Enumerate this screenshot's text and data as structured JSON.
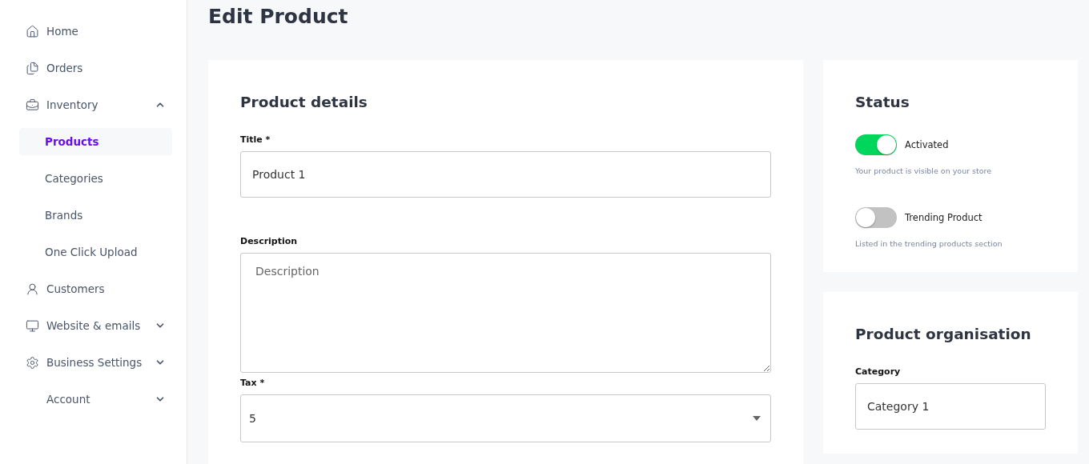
{
  "sidebar": {
    "items": [
      {
        "label": "Home",
        "selected": false
      },
      {
        "label": "Orders",
        "selected": false
      },
      {
        "label": "Inventory",
        "selected": false,
        "expanded": true,
        "children": [
          {
            "label": "Products",
            "selected": true
          },
          {
            "label": "Categories",
            "selected": false
          },
          {
            "label": "Brands",
            "selected": false
          },
          {
            "label": "One Click Upload",
            "selected": false
          }
        ]
      },
      {
        "label": "Customers",
        "selected": false
      },
      {
        "label": "Website & emails",
        "selected": false,
        "expanded": false
      },
      {
        "label": "Business Settings",
        "selected": false,
        "expanded": false
      },
      {
        "label": "Account",
        "selected": false,
        "expanded": false
      }
    ]
  },
  "page": {
    "title": "Edit Product"
  },
  "details": {
    "heading": "Product details",
    "fields": [
      {
        "kind": "text",
        "label": "Title *",
        "value": "Product 1"
      },
      {
        "kind": "textarea",
        "label": "Description",
        "placeholder": "Description"
      },
      {
        "kind": "select",
        "label": "Tax *",
        "value": "5"
      }
    ]
  },
  "status": {
    "heading": "Status",
    "toggles": [
      {
        "label": "Activated",
        "on": true,
        "hint": "Your product is visible on your store"
      },
      {
        "label": "Trending Product",
        "on": false,
        "hint": "Listed in the trending products section"
      }
    ]
  },
  "organisation": {
    "heading": "Product organisation",
    "fields": [
      {
        "kind": "text",
        "label": "Category",
        "value": "Category 1"
      }
    ]
  }
}
